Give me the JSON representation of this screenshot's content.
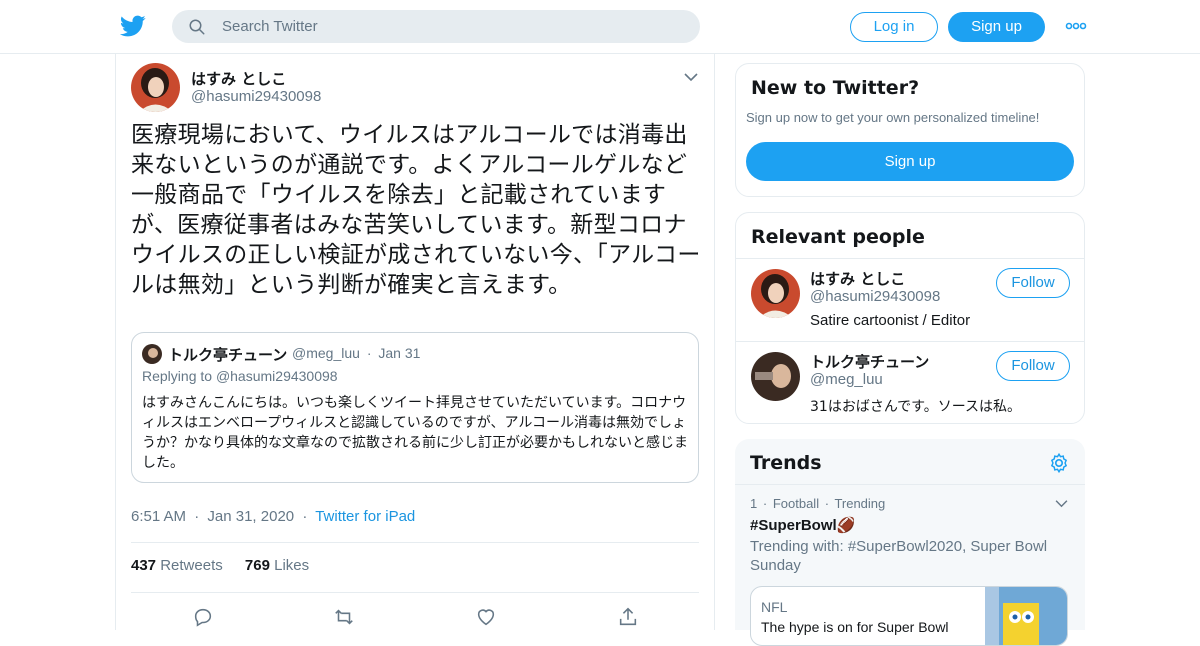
{
  "header": {
    "search_placeholder": "Search Twitter",
    "login_label": "Log in",
    "signup_label": "Sign up"
  },
  "tweet": {
    "author_name": "はすみ としこ",
    "author_handle": "@hasumi29430098",
    "text": "医療現場において、ウイルスはアルコールでは消毒出来ないというのが通説です。よくアルコールゲルなど一般商品で「ウイルスを除去」と記載されていますが、医療従事者はみな苦笑いしています。新型コロナウイルスの正しい検証が成されていない今、「アルコールは無効」という判断が確実と言えます。",
    "quote": {
      "author_name": "トルク亭チューン",
      "author_handle": "@meg_luu",
      "date": "Jan 31",
      "replying_to_label": "Replying to",
      "replying_to_handle": "@hasumi29430098",
      "text": "はすみさんこんにちは。いつも楽しくツイート拝見させていただいています。コロナウィルスはエンベロープウィルスと認識しているのですが、アルコール消毒は無効でしょうか？かなり具体的な文章なので拡散される前に少し訂正が必要かもしれないと感じました。"
    },
    "time": "6:51 AM",
    "date": "Jan 31, 2020",
    "source": "Twitter for iPad",
    "retweets_count": "437",
    "retweets_label": "Retweets",
    "likes_count": "769",
    "likes_label": "Likes"
  },
  "sidebar": {
    "new_to_twitter": {
      "title": "New to Twitter?",
      "subtitle": "Sign up now to get your own personalized timeline!",
      "signup_label": "Sign up"
    },
    "relevant_people": {
      "title": "Relevant people",
      "people": [
        {
          "name": "はすみ としこ",
          "handle": "@hasumi29430098",
          "bio": "Satire cartoonist / Editor",
          "follow_label": "Follow"
        },
        {
          "name": "トルク亭チューン",
          "handle": "@meg_luu",
          "bio": "31はおばさんです。ソースは私。",
          "follow_label": "Follow"
        }
      ]
    },
    "trends": {
      "title": "Trends",
      "items": [
        {
          "rank": "1",
          "category": "Football",
          "status": "Trending",
          "name": "#SuperBowl🏈",
          "trending_with": "Trending with: #SuperBowl2020, Super Bowl Sunday",
          "card_label": "NFL",
          "card_text": "The hype is on for Super Bowl"
        }
      ]
    }
  },
  "colors": {
    "accent": "#1da1f2",
    "text": "#14171a",
    "secondary": "#657786",
    "border": "#e6ecf0"
  }
}
